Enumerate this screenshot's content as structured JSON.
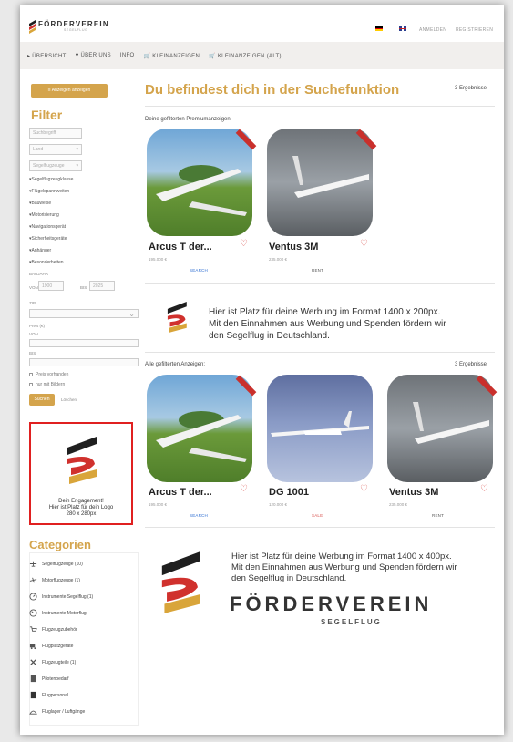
{
  "header": {
    "logo_text": "FÖRDERVEREIN",
    "logo_sub": "SEGELFLUG",
    "links": [
      "ANMELDEN",
      "REGISTRIEREN"
    ],
    "flags": [
      "de",
      "en"
    ]
  },
  "nav": {
    "items": [
      "ÜBERSICHT",
      "ÜBER UNS",
      "INFO",
      "KLEINANZEIGEN",
      "KLEINANZEIGEN (ALT)"
    ]
  },
  "sidebar": {
    "show_ads_button": "Anzeigen anzeigen",
    "filter_title": "Filter",
    "search_placeholder": "Suchbegriff",
    "land_select": "Land",
    "segelflugzeuge_select": "Segelflugzeuge",
    "filters": [
      "Segelflugzeugklasse",
      "Flügelspannweiten",
      "Bauweise",
      "Motorisierung",
      "Navigationsgerät",
      "Sicherheitsgeräte",
      "Anhänger",
      "Besonderheiten"
    ],
    "baujahr_label": "BAUJAHR",
    "von_label": "VON",
    "von_value": "1900",
    "bis_label": "BIS",
    "bis_value": "2025",
    "zip_label": "ZIP",
    "preis_label": "Preis (€)",
    "von2_label": "VON",
    "bis2_label": "BIS",
    "chk_preis": "Preis vorhanden",
    "chk_bilder": "nur mit Bildern",
    "go_button": "Suchen",
    "clear_link": "Löschen",
    "ad_caption_1": "Dein Engagement!",
    "ad_caption_2": "Hier ist Platz für dein Logo",
    "ad_caption_3": "280 x 280px",
    "categories_title": "Categorien",
    "categories": [
      {
        "label": "Segelflugzeuge (10)",
        "icon": "glider-icon"
      },
      {
        "label": "Motorflugzeuge (1)",
        "icon": "plane-icon"
      },
      {
        "label": "Instrumente Segelflug (1)",
        "icon": "gauge-icon"
      },
      {
        "label": "Instrumente Motorflug",
        "icon": "gauge-icon"
      },
      {
        "label": "Flugzeugzubehör",
        "icon": "cart-icon"
      },
      {
        "label": "Flugplatzgeräte",
        "icon": "truck-icon"
      },
      {
        "label": "Flugzeugteile (1)",
        "icon": "tools-icon"
      },
      {
        "label": "Pilotenbedarf",
        "icon": "pilot-icon"
      },
      {
        "label": "Flugpersonal",
        "icon": "person-icon"
      },
      {
        "label": "Fluglager / Luftgänge",
        "icon": "hangar-icon"
      }
    ]
  },
  "main": {
    "headline": "Du befindest dich in der Suchefunktion",
    "result_count": "3 Ergebnisse",
    "premium_label": "Deine gefilterten Premiumanzeigen:",
    "premium_cards": [
      {
        "title": "Arcus T der...",
        "price": "195.000 €",
        "tag": "SEARCH"
      },
      {
        "title": "Ventus 3M",
        "price": "235.000 €",
        "tag": "RENT"
      }
    ],
    "ad1_text_1": "Hier ist Platz für deine Werbung im Format 1400 x 200px.",
    "ad1_text_2": "Mit den Einnahmen aus Werbung und Spenden fördern wir",
    "ad1_text_3": "den Segelflug in Deutschland.",
    "all_label": "Alle gefilterten Anzeigen:",
    "all_count": "3 Ergebnisse",
    "all_cards": [
      {
        "title": "Arcus T der...",
        "price": "195.000 €",
        "tag": "SEARCH"
      },
      {
        "title": "DG 1001",
        "price": "120.000 €",
        "tag": "SALE"
      },
      {
        "title": "Ventus 3M",
        "price": "235.000 €",
        "tag": "RENT"
      }
    ],
    "ad2_text_1": "Hier ist Platz für deine Werbung im Format 1400 x 400px.",
    "ad2_text_2": "Mit den Einnahmen aus Werbung und Spenden fördern wir",
    "ad2_text_3": "den Segelflug in Deutschland.",
    "ad2_brand": "FÖRDERVEREIN",
    "ad2_brand_sub": "SEGELFLUG"
  },
  "colors": {
    "accent": "#d4a44c",
    "flag_black": "#1f1f1f",
    "flag_red": "#d0312d",
    "flag_gold": "#d9a53a",
    "heart": "#d9534f",
    "highlight_border": "#e02020"
  }
}
